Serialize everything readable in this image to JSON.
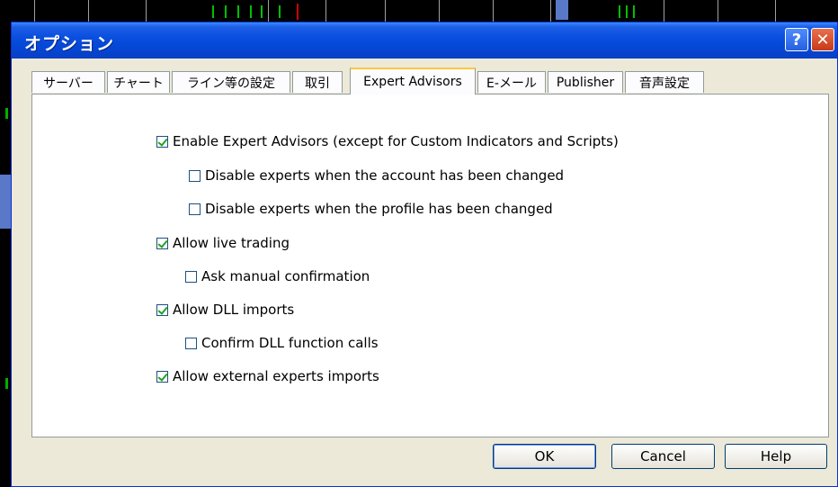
{
  "window": {
    "title": "オプション",
    "help_symbol": "?",
    "close_symbol": "✕"
  },
  "tabs": [
    {
      "label": "サーバー"
    },
    {
      "label": "チャート"
    },
    {
      "label": "ライン等の設定"
    },
    {
      "label": "取引"
    },
    {
      "label": "Expert Advisors",
      "active": true
    },
    {
      "label": "E-メール"
    },
    {
      "label": "Publisher"
    },
    {
      "label": "音声設定"
    }
  ],
  "options": [
    {
      "label": "Enable Expert Advisors (except for Custom Indicators and Scripts)",
      "checked": true
    },
    {
      "label": "Disable experts when the account has been changed",
      "checked": false
    },
    {
      "label": "Disable experts when the profile has been changed",
      "checked": false
    },
    {
      "label": "Allow live trading",
      "checked": true
    },
    {
      "label": "Ask manual confirmation",
      "checked": false
    },
    {
      "label": "Allow DLL imports",
      "checked": true
    },
    {
      "label": "Confirm DLL function calls",
      "checked": false
    },
    {
      "label": "Allow external experts imports",
      "checked": true
    }
  ],
  "buttons": {
    "ok": "OK",
    "cancel": "Cancel",
    "help": "Help"
  },
  "colors": {
    "titlebar": "#0a4fe0",
    "active_tab_accent": "#ffc83c",
    "checkmark": "#21a121"
  }
}
